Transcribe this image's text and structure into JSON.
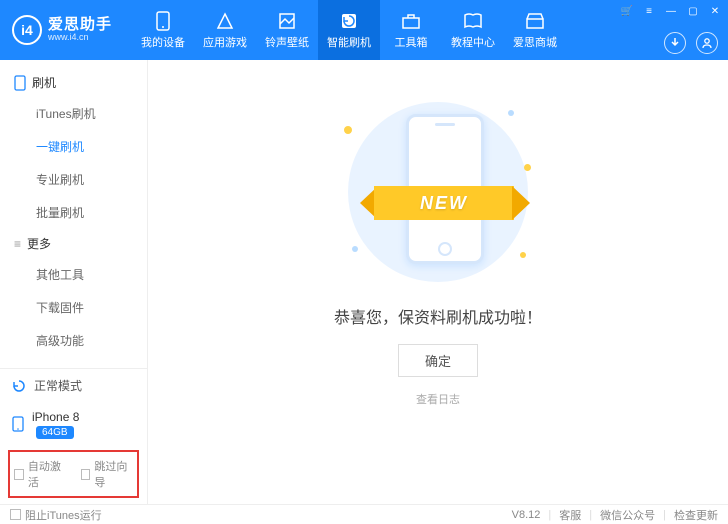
{
  "app": {
    "name": "爱思助手",
    "url": "www.i4.cn",
    "logo_text": "i4",
    "version": "V8.12"
  },
  "nav": [
    {
      "label": "我的设备"
    },
    {
      "label": "应用游戏"
    },
    {
      "label": "铃声壁纸"
    },
    {
      "label": "智能刷机"
    },
    {
      "label": "工具箱"
    },
    {
      "label": "教程中心"
    },
    {
      "label": "爱思商城"
    }
  ],
  "sidebar": {
    "group1": "刷机",
    "items1": [
      "iTunes刷机",
      "一键刷机",
      "专业刷机",
      "批量刷机"
    ],
    "group2": "更多",
    "items2": [
      "其他工具",
      "下载固件",
      "高级功能"
    ],
    "mode": "正常模式",
    "device": {
      "name": "iPhone 8",
      "storage": "64GB"
    },
    "checks": {
      "autoActivate": "自动激活",
      "skipGuide": "跳过向导"
    }
  },
  "main": {
    "ribbon": "NEW",
    "message": "恭喜您，保资料刷机成功啦！",
    "confirm": "确定",
    "viewLog": "查看日志"
  },
  "footer": {
    "blockItunes": "阻止iTunes运行",
    "links": [
      "客服",
      "微信公众号",
      "检查更新"
    ]
  }
}
